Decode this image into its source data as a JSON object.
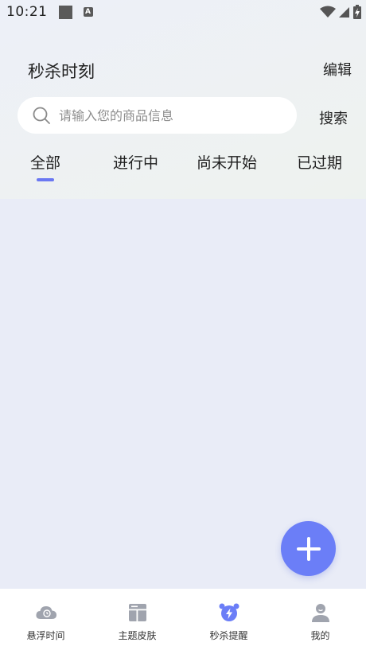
{
  "status_bar": {
    "time": "10:21",
    "notification_letter": "A"
  },
  "header": {
    "title": "秒杀时刻",
    "edit_label": "编辑"
  },
  "search": {
    "placeholder": "请输入您的商品信息",
    "value": "",
    "button_label": "搜索"
  },
  "tabs": [
    {
      "label": "全部",
      "active": true
    },
    {
      "label": "进行中",
      "active": false
    },
    {
      "label": "尚未开始",
      "active": false
    },
    {
      "label": "已过期",
      "active": false
    }
  ],
  "fab": {
    "icon": "plus-icon"
  },
  "bottom_nav": [
    {
      "label": "悬浮时间",
      "icon": "cloud-clock-icon",
      "active": false
    },
    {
      "label": "主题皮肤",
      "icon": "layout-icon",
      "active": false
    },
    {
      "label": "秒杀提醒",
      "icon": "alarm-clock-icon",
      "active": true
    },
    {
      "label": "我的",
      "icon": "user-icon",
      "active": false
    }
  ],
  "colors": {
    "accent": "#6b7ef7",
    "tab_indicator": "#6b78f2",
    "nav_icon": "#9fa3ad"
  }
}
